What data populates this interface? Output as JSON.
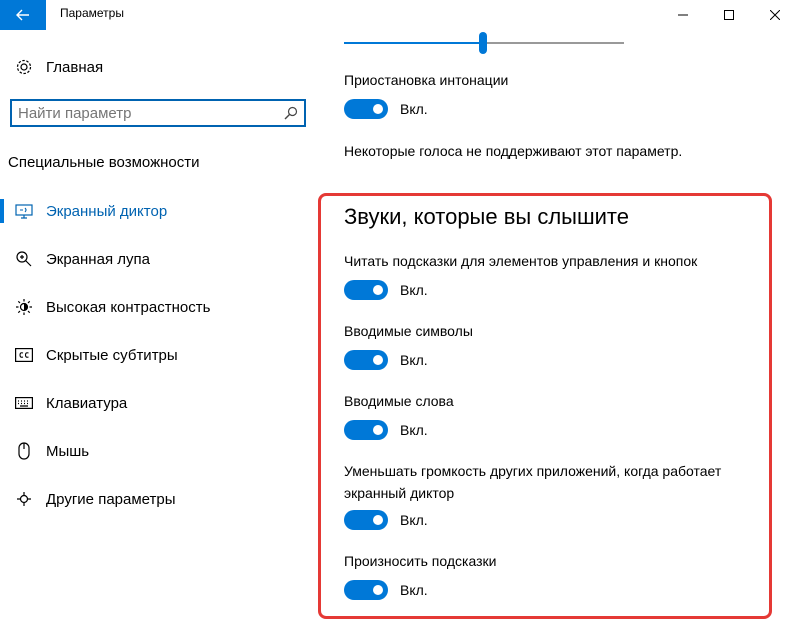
{
  "window": {
    "title": "Параметры"
  },
  "sidebar": {
    "home_label": "Главная",
    "search_placeholder": "Найти параметр",
    "section_label": "Специальные возможности",
    "items": [
      {
        "label": "Экранный диктор",
        "icon": "narrator-icon",
        "active": true
      },
      {
        "label": "Экранная лупа",
        "icon": "magnifier-icon"
      },
      {
        "label": "Высокая контрастность",
        "icon": "high-contrast-icon"
      },
      {
        "label": "Скрытые субтитры",
        "icon": "closed-captions-icon"
      },
      {
        "label": "Клавиатура",
        "icon": "keyboard-icon"
      },
      {
        "label": "Мышь",
        "icon": "mouse-icon"
      },
      {
        "label": "Другие параметры",
        "icon": "other-options-icon"
      }
    ]
  },
  "content": {
    "slider_value": 0.5,
    "intonation": {
      "label": "Приостановка интонации",
      "state": "Вкл."
    },
    "note": "Некоторые голоса не поддерживают этот параметр.",
    "sounds_section": {
      "title": "Звуки, которые вы слышите",
      "settings": [
        {
          "label": "Читать подсказки для элементов управления и кнопок",
          "state": "Вкл."
        },
        {
          "label": "Вводимые символы",
          "state": "Вкл."
        },
        {
          "label": "Вводимые слова",
          "state": "Вкл."
        },
        {
          "label": "Уменьшать громкость других приложений, когда работает экранный диктор",
          "state": "Вкл."
        },
        {
          "label": "Произносить подсказки",
          "state": "Вкл."
        }
      ]
    }
  },
  "colors": {
    "accent": "#0078d7",
    "highlight": "#e53935"
  }
}
